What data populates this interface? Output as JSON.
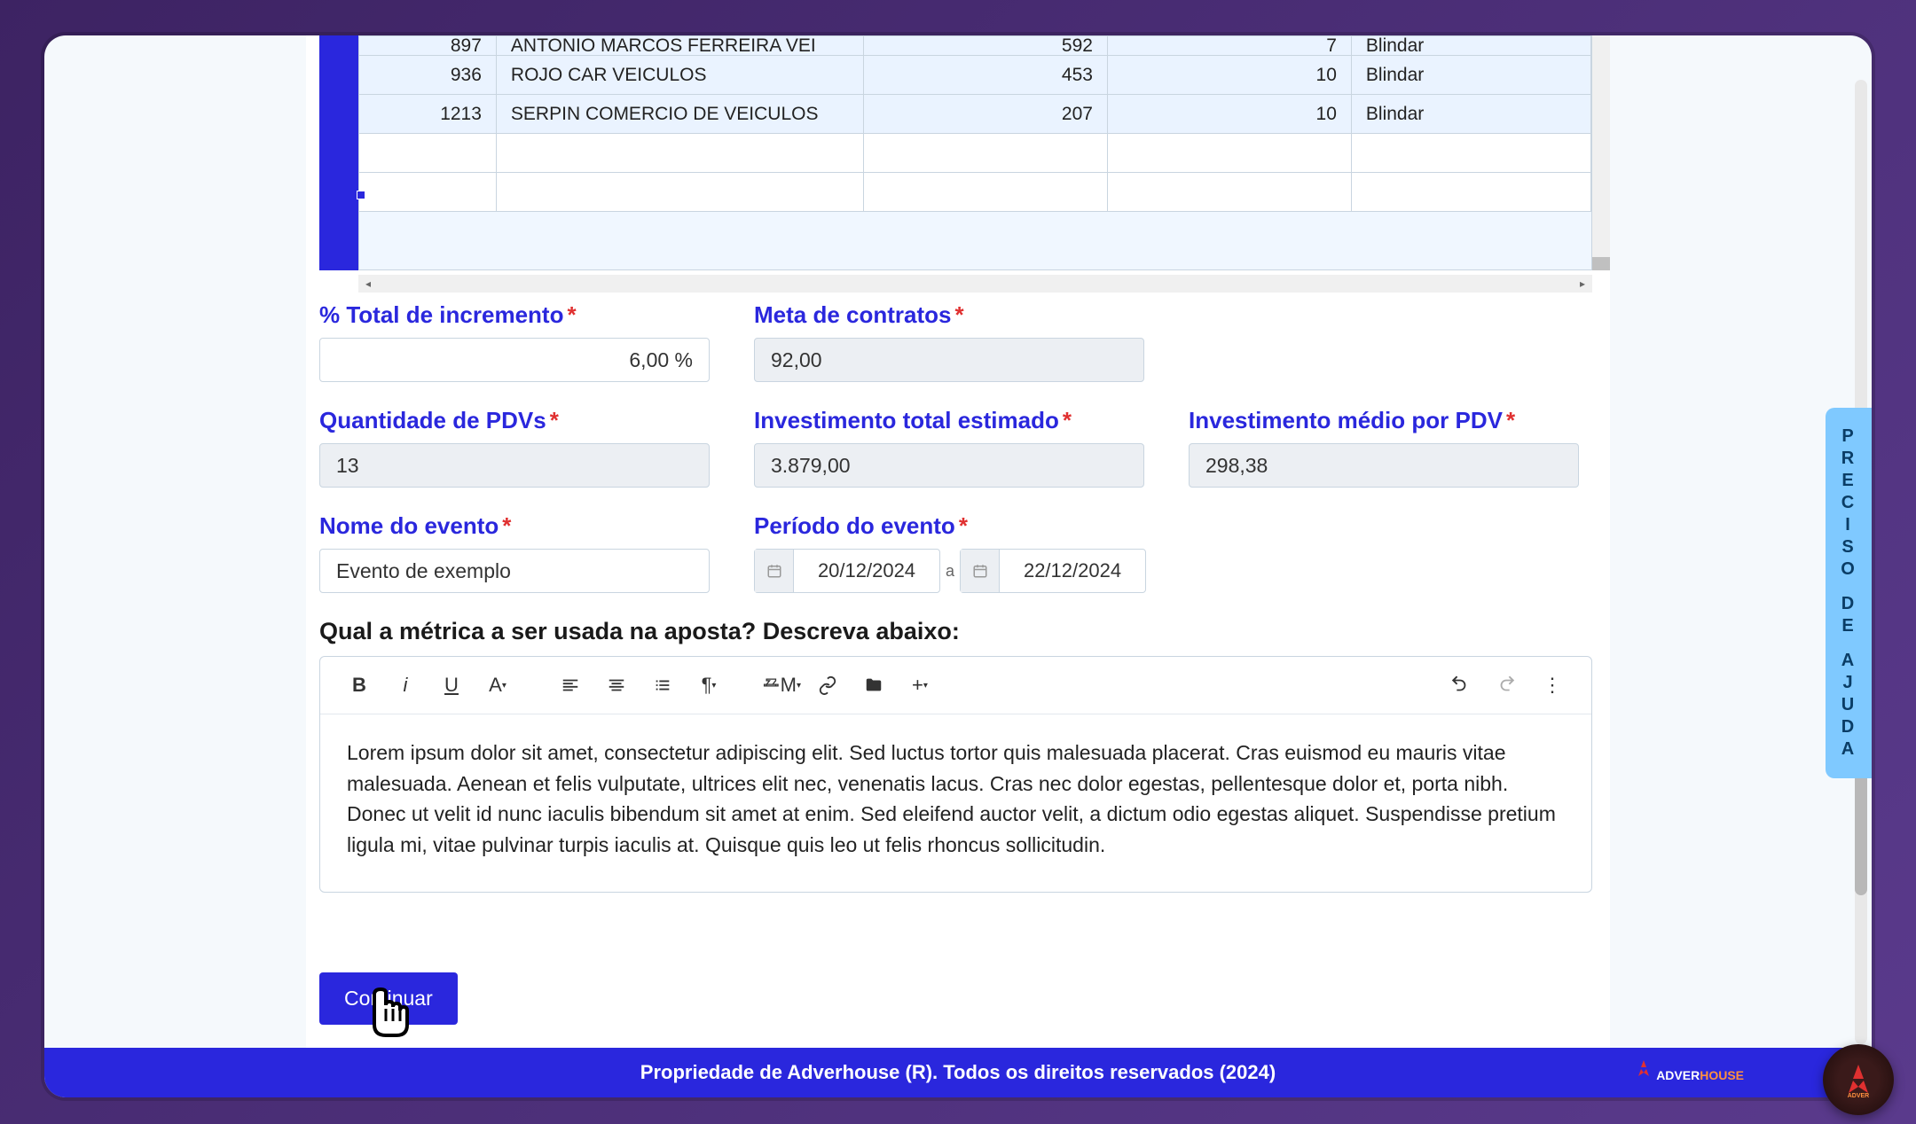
{
  "spreadsheet": {
    "rows": [
      {
        "code": "897",
        "name": "ANTONIO MARCOS FERREIRA VEI",
        "v1": "592",
        "v2": "7",
        "cat": "Blindar"
      },
      {
        "code": "936",
        "name": "ROJO CAR VEICULOS",
        "v1": "453",
        "v2": "10",
        "cat": "Blindar"
      },
      {
        "code": "1213",
        "name": "SERPIN COMERCIO DE VEICULOS",
        "v1": "207",
        "v2": "10",
        "cat": "Blindar"
      }
    ]
  },
  "form": {
    "total_incremento": {
      "label": "% Total de incremento",
      "value": "6,00 %"
    },
    "meta_contratos": {
      "label": "Meta de contratos",
      "value": "92,00"
    },
    "qtd_pdvs": {
      "label": "Quantidade de PDVs",
      "value": "13"
    },
    "invest_total": {
      "label": "Investimento total estimado",
      "value": "3.879,00"
    },
    "invest_medio": {
      "label": "Investimento médio por PDV",
      "value": "298,38"
    },
    "nome_evento": {
      "label": "Nome do evento",
      "value": "Evento de exemplo"
    },
    "periodo_evento": {
      "label": "Período do evento",
      "start": "20/12/2024",
      "end": "22/12/2024",
      "sep": "a"
    },
    "metrica_label": "Qual a métrica a ser usada na aposta? Descreva abaixo:",
    "metrica_body": "Lorem ipsum dolor sit amet, consectetur adipiscing elit. Sed luctus tortor quis malesuada placerat. Cras euismod eu mauris vitae malesuada. Aenean et felis vulputate, ultrices elit nec, venenatis lacus. Cras nec dolor egestas, pellentesque dolor et, porta nibh. Donec ut velit id nunc iaculis bibendum sit amet at enim. Sed eleifend auctor velit, a dictum odio egestas aliquet. Suspendisse pretium ligula mi, vitae pulvinar turpis iaculis at. Quisque quis leo ut felis rhoncus sollicitudin.",
    "continue_label": "Continuar"
  },
  "help_tab": {
    "line1": "PRECISO",
    "line2": "DE",
    "line3": "AJUDA"
  },
  "footer": {
    "text": "Propriedade de Adverhouse (R). Todos os direitos reservados (2024)",
    "logo1": "ADVER",
    "logo2": "HOUSE"
  }
}
